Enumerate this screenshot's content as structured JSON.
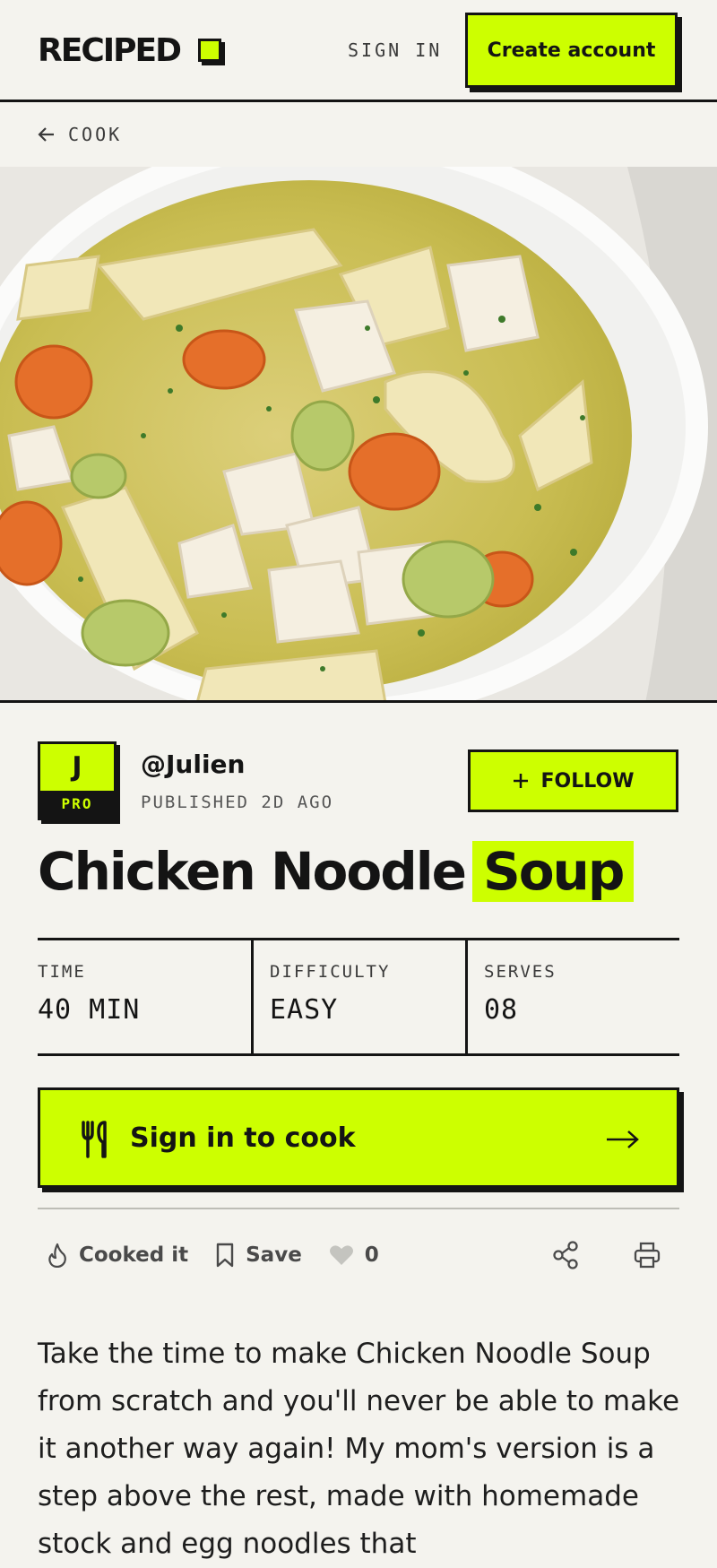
{
  "header": {
    "logo": "RECIPED",
    "sign_in": "SIGN IN",
    "create_account": "Create account"
  },
  "breadcrumb": {
    "label": "COOK"
  },
  "author": {
    "initial": "J",
    "badge": "PRO",
    "handle": "@Julien",
    "published": "PUBLISHED 2D AGO",
    "follow_label": "FOLLOW"
  },
  "recipe": {
    "title_main": "Chicken Noodle",
    "title_highlight": "Soup",
    "stats": [
      {
        "label": "TIME",
        "value": "40 MIN"
      },
      {
        "label": "DIFFICULTY",
        "value": "EASY"
      },
      {
        "label": "SERVES",
        "value": "08"
      }
    ],
    "cook_cta": "Sign in to cook",
    "actions": {
      "cooked": "Cooked it",
      "save": "Save",
      "likes": "0"
    },
    "description": "Take the time to make Chicken Noodle Soup from scratch and you'll never be able to make it another way again! My mom's version is a step above the rest, made with homemade stock and egg noodles that"
  },
  "colors": {
    "accent": "#cdff00",
    "ink": "#141414",
    "background": "#f4f3ee"
  }
}
